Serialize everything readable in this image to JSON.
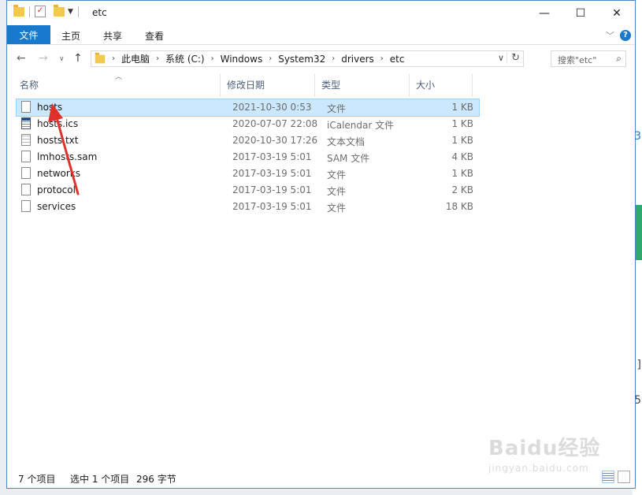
{
  "window": {
    "title": "etc"
  },
  "title_controls": {
    "minimize": "—",
    "maximize": "☐",
    "close": "✕"
  },
  "ribbon": {
    "file_tab": "文件",
    "tabs": [
      "主页",
      "共享",
      "查看"
    ],
    "help": "?"
  },
  "nav": {
    "breadcrumbs": [
      "此电脑",
      "系统 (C:)",
      "Windows",
      "System32",
      "drivers",
      "etc"
    ],
    "search_placeholder": "搜索\"etc\""
  },
  "columns": [
    "名称",
    "修改日期",
    "类型",
    "大小"
  ],
  "files": [
    {
      "name": "hosts",
      "date": "2021-10-30 0:53",
      "type": "文件",
      "size": "1 KB",
      "icon": "file-icon",
      "selected": true
    },
    {
      "name": "hosts.ics",
      "date": "2020-07-07 22:08",
      "type": "iCalendar 文件",
      "size": "1 KB",
      "icon": "calendar-file-icon",
      "selected": false
    },
    {
      "name": "hosts.txt",
      "date": "2020-10-30 17:26",
      "type": "文本文档",
      "size": "1 KB",
      "icon": "text-file-icon",
      "selected": false
    },
    {
      "name": "lmhosts.sam",
      "date": "2017-03-19 5:01",
      "type": "SAM 文件",
      "size": "4 KB",
      "icon": "file-icon",
      "selected": false
    },
    {
      "name": "networks",
      "date": "2017-03-19 5:01",
      "type": "文件",
      "size": "1 KB",
      "icon": "file-icon",
      "selected": false
    },
    {
      "name": "protocol",
      "date": "2017-03-19 5:01",
      "type": "文件",
      "size": "2 KB",
      "icon": "file-icon",
      "selected": false
    },
    {
      "name": "services",
      "date": "2017-03-19 5:01",
      "type": "文件",
      "size": "18 KB",
      "icon": "file-icon",
      "selected": false
    }
  ],
  "status": {
    "count": "7 个项目",
    "selected": "选中 1 个项目",
    "size": "296 字节"
  },
  "watermark": {
    "line1": "Baidu经验",
    "line2": "jingyan.baidu.com"
  },
  "background_edge": {
    "letters": [
      "3",
      "]",
      "5"
    ]
  },
  "colors": {
    "accent": "#1979ca",
    "selection": "#cce8ff",
    "annotation_arrow": "#e0302a"
  }
}
